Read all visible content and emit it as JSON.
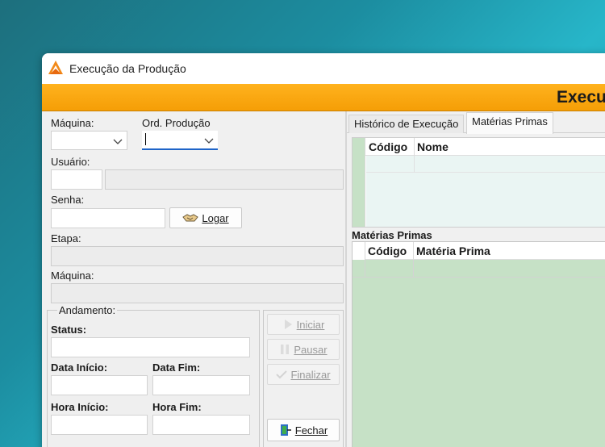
{
  "window": {
    "title": "Execução da Produção"
  },
  "banner": {
    "title": "Execução da Produção"
  },
  "login": {
    "maquina_label": "Máquina:",
    "ord_producao_label": "Ord. Produção",
    "usuario_label": "Usuário:",
    "senha_label": "Senha:",
    "logar_label": "Logar",
    "etapa_label": "Etapa:",
    "maquina2_label": "Máquina:"
  },
  "andamento": {
    "title": "Andamento:",
    "status_label": "Status:",
    "data_inicio_label": "Data Início:",
    "data_fim_label": "Data Fim:",
    "hora_inicio_label": "Hora Início:",
    "hora_fim_label": "Hora Fim:"
  },
  "actions": {
    "iniciar": "Iniciar",
    "pausar": "Pausar",
    "finalizar": "Finalizar",
    "fechar": "Fechar"
  },
  "tabs": [
    {
      "label": "Histórico de Execução",
      "selected": false
    },
    {
      "label": "Matérias Primas",
      "selected": true
    }
  ],
  "grid_top": {
    "columns": [
      "Código",
      "Nome"
    ]
  },
  "materias_section": {
    "title": "Matérias Primas",
    "columns": [
      "Código",
      "Matéria Prima"
    ]
  },
  "colors": {
    "banner": "#f59e06",
    "grid_green": "#c6e1c6",
    "focus_blue": "#1e64c8"
  }
}
